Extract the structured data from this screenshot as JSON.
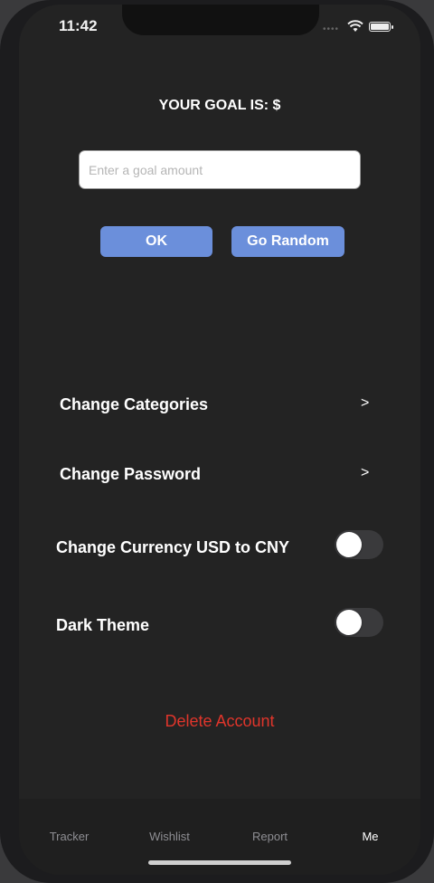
{
  "status": {
    "time": "11:42"
  },
  "goal": {
    "title": "YOUR GOAL IS: $",
    "input_placeholder": "Enter a goal amount",
    "input_value": "",
    "ok_label": "OK",
    "random_label": "Go Random"
  },
  "settings": {
    "change_categories": "Change Categories",
    "change_password": "Change Password",
    "arrow": ">",
    "change_currency": "Change Currency USD to CNY",
    "change_currency_on": false,
    "dark_theme": "Dark Theme",
    "dark_theme_on": false
  },
  "delete_account": "Delete Account",
  "tabs": [
    {
      "label": "Tracker",
      "active": false
    },
    {
      "label": "Wishlist",
      "active": false
    },
    {
      "label": "Report",
      "active": false
    },
    {
      "label": "Me",
      "active": true
    }
  ],
  "colors": {
    "accent": "#6b8fdb",
    "danger": "#e0352b",
    "background": "#232323"
  }
}
